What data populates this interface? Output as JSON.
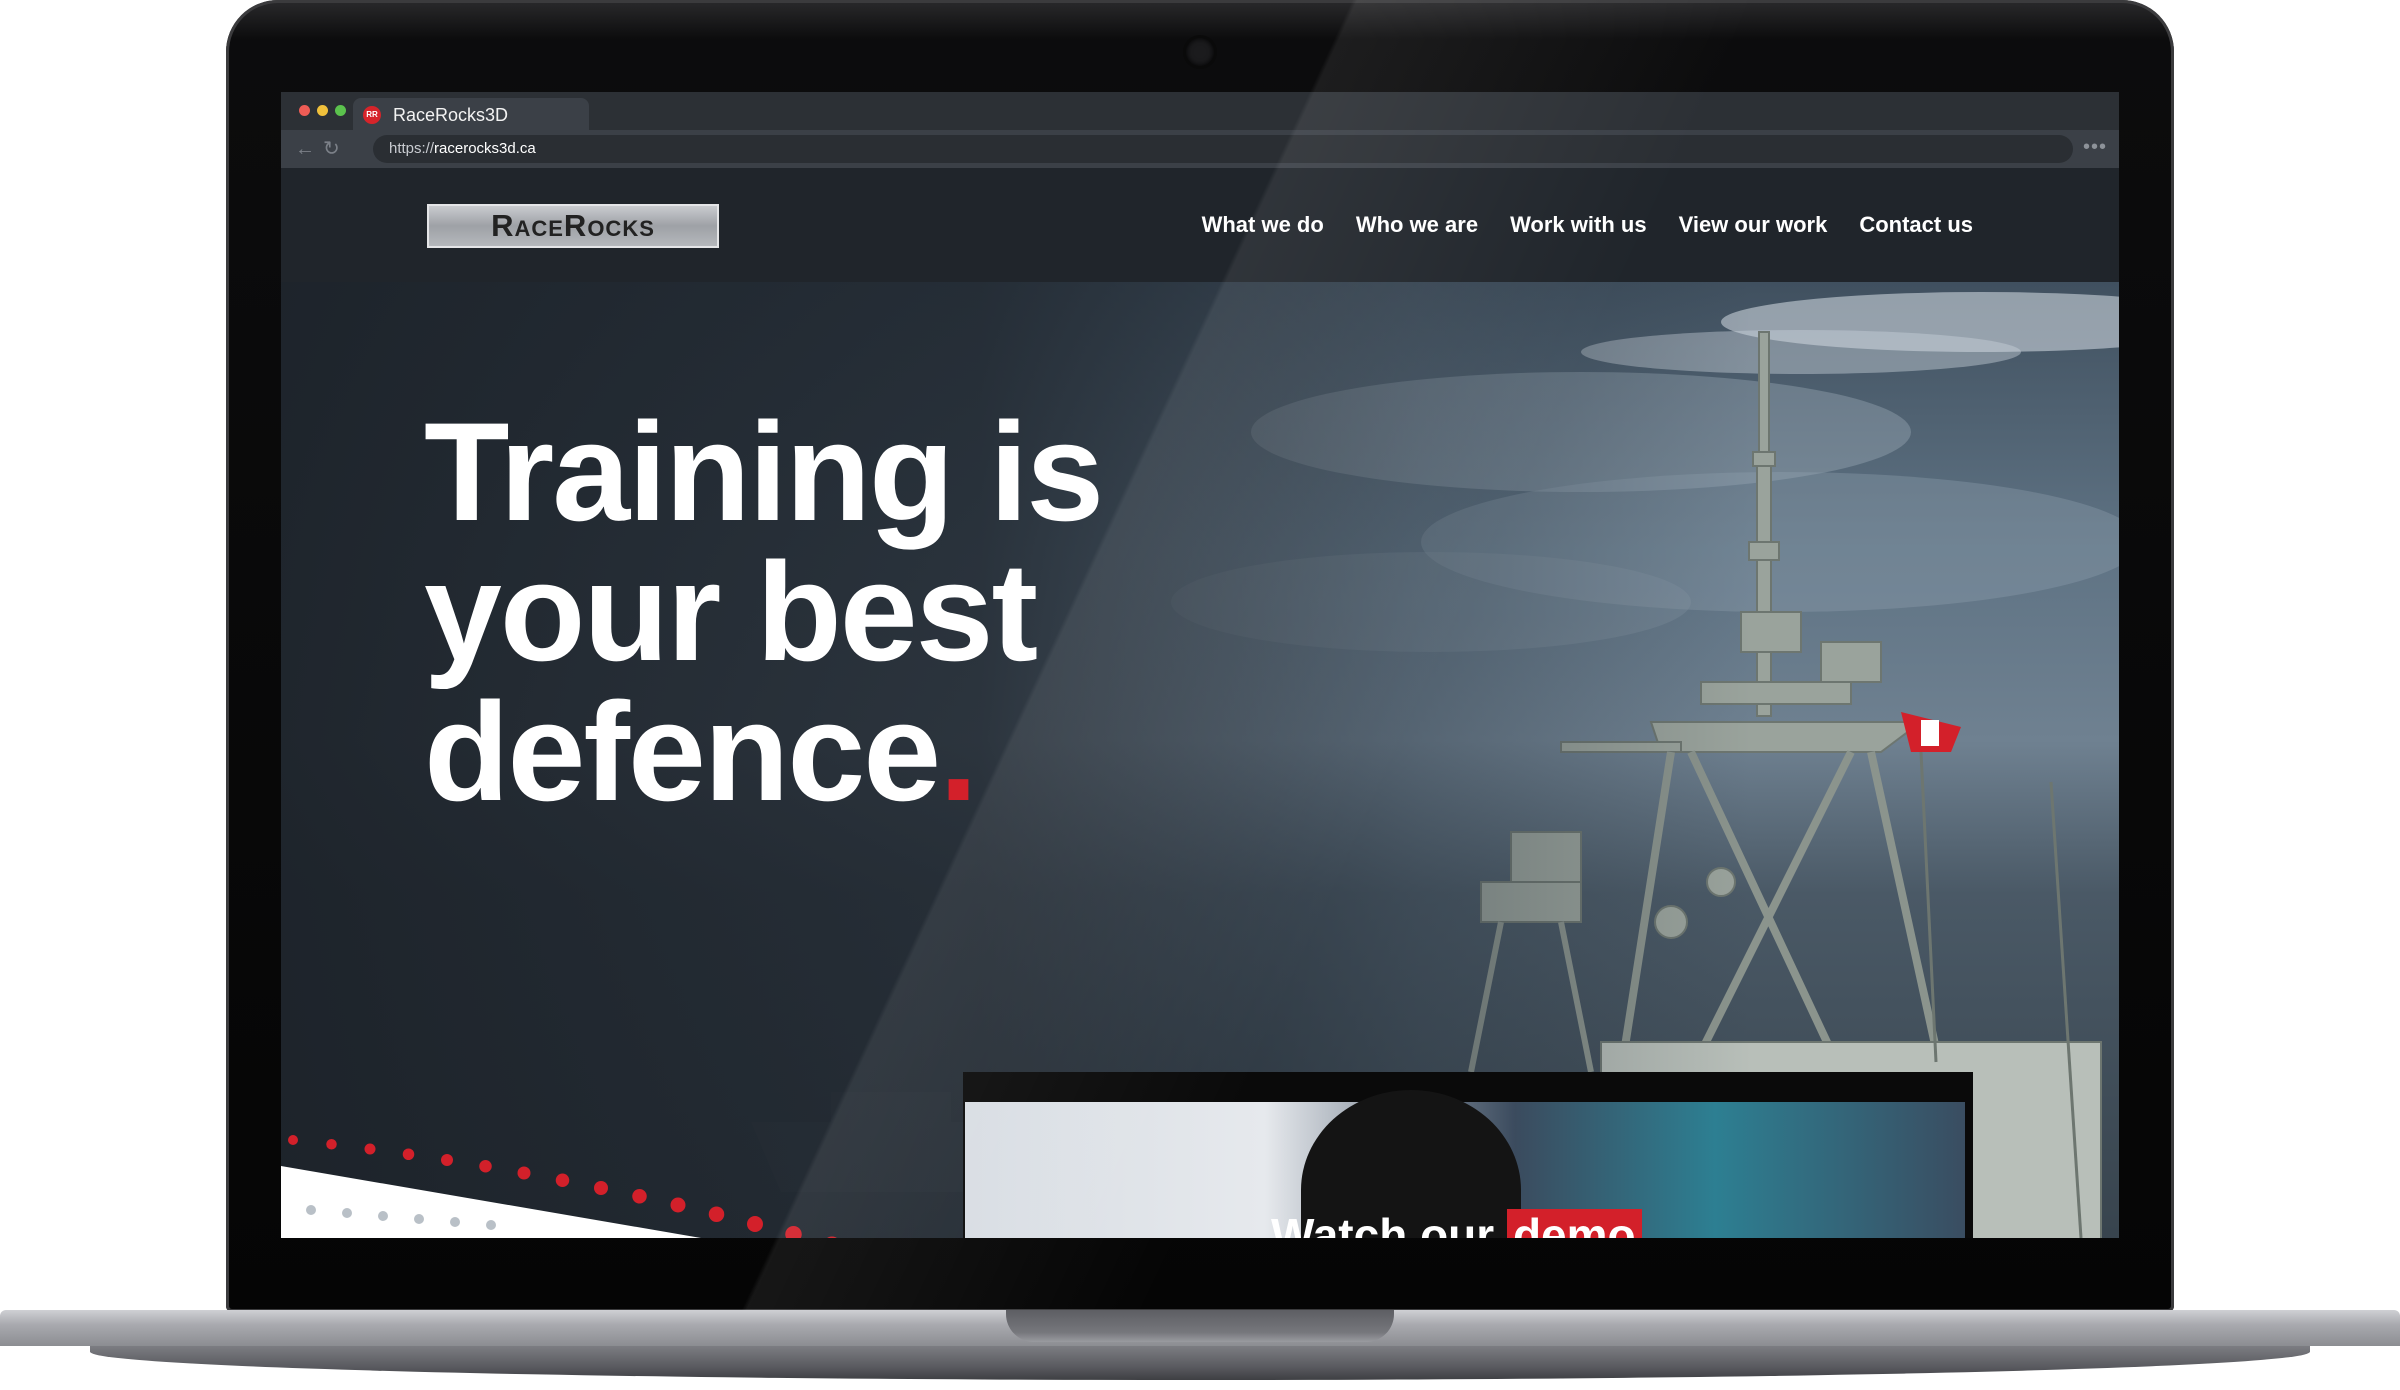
{
  "browser": {
    "tab_title": "RaceRocks3D",
    "favicon_text": "RR",
    "url_scheme": "https://",
    "url_host": "racerocks3d.ca",
    "menu": "•••"
  },
  "site": {
    "logo_text": "RaceRocks",
    "nav": [
      "What we do",
      "Who we are",
      "Work with us",
      "View our work",
      "Contact us"
    ]
  },
  "hero": {
    "headline_line1": "Training is",
    "headline_line2": "your best",
    "headline_line3": "defence",
    "headline_period": ".",
    "cta_prefix": "Watch our ",
    "cta_highlight": "demo"
  },
  "colors": {
    "accent_red": "#d3202a",
    "header_bg": "#20252b",
    "chrome_bg": "#3b4047"
  },
  "icons": {
    "back": "arrow-left-icon",
    "reload": "reload-icon",
    "menu": "more-horizontal-icon"
  }
}
